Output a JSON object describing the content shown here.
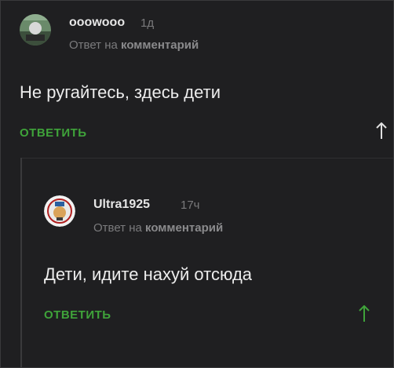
{
  "comments": [
    {
      "username": "ooowooo",
      "time": "1д",
      "reply_prefix": "Ответ на",
      "reply_target": "комментарий",
      "text": "Не ругайтесь, здесь дети",
      "reply_label": "ОТВЕТИТЬ"
    },
    {
      "username": "Ultra1925",
      "time": "17ч",
      "reply_prefix": "Ответ на",
      "reply_target": "комментарий",
      "text": "Дети, идите нахуй отсюда",
      "reply_label": "ОТВЕТИТЬ"
    }
  ],
  "colors": {
    "background": "#1f1f21",
    "accent_green": "#3fa33a",
    "muted_text": "#7b7b7d"
  },
  "icons": {
    "up_arrow": "up-arrow-icon",
    "avatar1": "avatar-image",
    "avatar2": "avatar-badge"
  }
}
